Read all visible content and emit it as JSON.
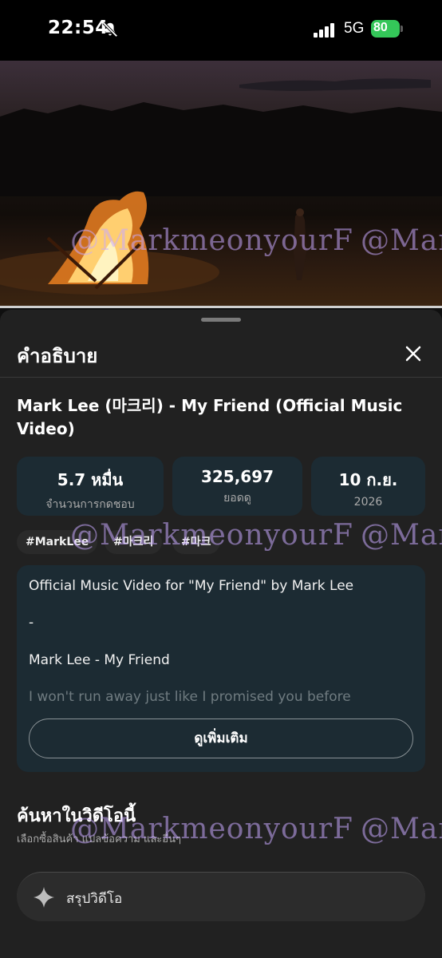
{
  "status_bar": {
    "time": "22:54",
    "network": "5G",
    "battery": "80"
  },
  "watermark": "@MarkmeonyourF",
  "sheet": {
    "title": "คำอธิบาย",
    "video_title": "Mark Lee (마크리) - My Friend (Official Music Video)",
    "stats": [
      {
        "value": "5.7 หมื่น",
        "label": "จำนวนการกดชอบ"
      },
      {
        "value": "325,697",
        "label": "ยอดดู"
      },
      {
        "value": "10 ก.ย.",
        "label": "2026"
      }
    ],
    "hashtags": [
      "#MarkLee",
      "#마크리",
      "#마크"
    ],
    "description": [
      "Official Music Video for \"My Friend\" by Mark Lee",
      "-",
      "Mark Lee - My Friend",
      "I won't run away just like I promised you before"
    ],
    "show_more": "ดูเพิ่มเติม",
    "search": {
      "title": "ค้นหาในวิดีโอนี้",
      "subtitle": "เลือกซื้อสินค้า แปลข้อความ และอื่นๆ"
    },
    "summary_button": "สรุปวิดีโอ"
  },
  "colors": {
    "background": "#0f0f0f",
    "sheet": "#212121",
    "card": "#1c2b33",
    "battery": "#34c759"
  }
}
